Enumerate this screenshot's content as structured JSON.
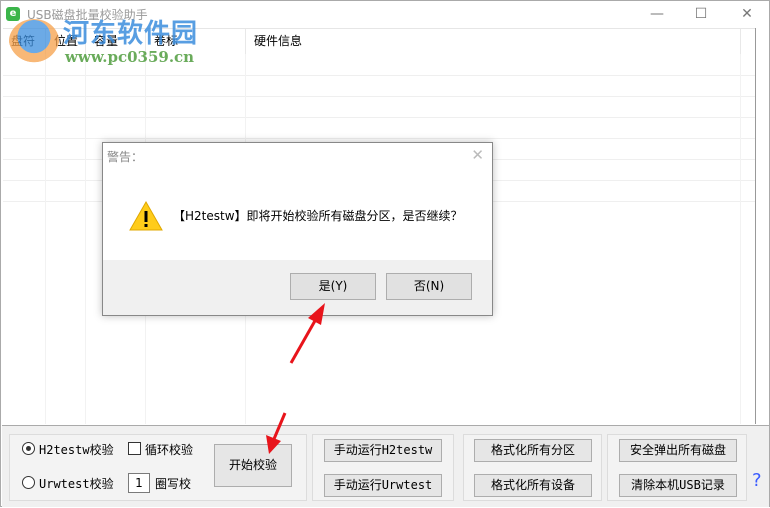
{
  "window": {
    "title": "USB磁盘批量校验助手",
    "app_icon": "e",
    "minimize": "—",
    "maximize": "☐",
    "close": "✕"
  },
  "watermark": {
    "name": "河东软件园",
    "url": "www.pc0359.cn"
  },
  "table": {
    "columns": [
      "盘符",
      "位置",
      "容量",
      "卷标",
      "硬件信息"
    ]
  },
  "options": {
    "h2testw": "H2testw校验",
    "urwtest": "Urwtest校验",
    "loop": "循环校验",
    "loop_count": "1",
    "loop_suffix": "圈写校",
    "selected": "H2testw"
  },
  "buttons": {
    "start": "开始校验",
    "run_h2testw": "手动运行H2testw",
    "run_urwtest": "手动运行Urwtest",
    "format_partitions": "格式化所有分区",
    "format_devices": "格式化所有设备",
    "eject_all": "安全弹出所有磁盘",
    "clear_usb": "清除本机USB记录",
    "help": "?"
  },
  "dialog": {
    "title": "警告：",
    "message": "【H2testw】即将开始校验所有磁盘分区，是否继续？",
    "yes": "是(Y)",
    "no": "否(N)",
    "close": "✕",
    "icon": "warning-icon"
  },
  "colors": {
    "arrow": "#e8141b",
    "accent": "#3a5bff"
  }
}
